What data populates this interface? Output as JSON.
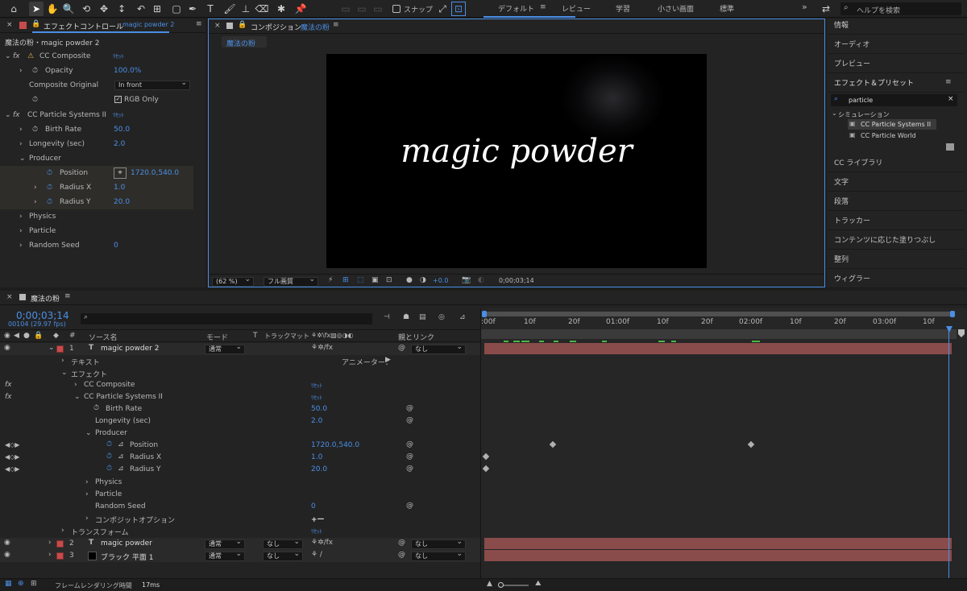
{
  "toolbar": {
    "snap_label": "スナップ",
    "search_placeholder": "ヘルプを検索",
    "workspaces": [
      "デフォルト",
      "レビュー",
      "学習",
      "小さい画面",
      "標準"
    ],
    "more": "»"
  },
  "effects_panel": {
    "tab_label": "エフェクトコントロール",
    "tab_layer": "magic powder 2",
    "breadcrumb": "魔法の粉・magic powder 2",
    "reset": "ﾘｾｯﾄ",
    "cc_composite": {
      "name": "CC Composite",
      "opacity_label": "Opacity",
      "opacity_value": "100.0%",
      "composite_original_label": "Composite Original",
      "composite_original_value": "In front",
      "rgb_only_label": "RGB Only"
    },
    "cc_particle": {
      "name": "CC Particle Systems II",
      "birth_rate_label": "Birth Rate",
      "birth_rate_value": "50.0",
      "longevity_label": "Longevity (sec)",
      "longevity_value": "2.0",
      "producer_label": "Producer",
      "position_label": "Position",
      "position_value": "1720.0,540.0",
      "radius_x_label": "Radius X",
      "radius_x_value": "1.0",
      "radius_y_label": "Radius Y",
      "radius_y_value": "20.0",
      "physics_label": "Physics",
      "particle_label": "Particle",
      "random_seed_label": "Random Seed",
      "random_seed_value": "0"
    }
  },
  "comp_panel": {
    "tab_prefix": "コンポジション",
    "tab_name": "魔法の粉",
    "subtab": "魔法の粉",
    "canvas_text": "magic powder",
    "zoom": "(62 %)",
    "quality": "フル画質",
    "exposure": "+0.0",
    "timecode": "0;00;03;14"
  },
  "right_panel": {
    "items_top": [
      "情報",
      "オーディオ",
      "プレビュー"
    ],
    "effects_presets_label": "エフェクト＆プリセット",
    "search_value": "particle",
    "category": "シミュレーション",
    "results": [
      "CC Particle Systems II",
      "CC Particle World"
    ],
    "items_bottom": [
      "CC ライブラリ",
      "文字",
      "段落",
      "トラッカー",
      "コンテンツに応じた塗りつぶし",
      "整列",
      "ウィグラー"
    ]
  },
  "timeline": {
    "tab_label": "魔法の粉",
    "timecode": "0;00;03;14",
    "frame_info": "00104 (29.97 fps)",
    "columns": {
      "source_name": "ソース名",
      "mode": "モード",
      "t": "T",
      "track_matte": "トラックマット",
      "parent": "親とリンク"
    },
    "layers": [
      {
        "num": "1",
        "name": "magic powder 2",
        "mode": "通常",
        "parent": "なし"
      },
      {
        "num": "2",
        "name": "magic powder",
        "mode": "通常",
        "matte": "なし",
        "parent": "なし"
      },
      {
        "num": "3",
        "name": "ブラック 平面 1",
        "mode": "通常",
        "matte": "なし",
        "parent": "なし"
      }
    ],
    "props": {
      "text": "テキスト",
      "animator": "アニメーター：",
      "effects": "エフェクト",
      "cc_composite": "CC Composite",
      "cc_particle": "CC Particle Systems II",
      "birth_rate": "Birth Rate",
      "birth_rate_value": "50.0",
      "longevity": "Longevity (sec)",
      "longevity_value": "2.0",
      "producer": "Producer",
      "position": "Position",
      "position_value": "1720.0,540.0",
      "radius_x": "Radius X",
      "radius_x_value": "1.0",
      "radius_y": "Radius Y",
      "radius_y_value": "20.0",
      "physics": "Physics",
      "particle": "Particle",
      "random_seed": "Random Seed",
      "random_seed_value": "0",
      "composite_options": "コンポジットオプション",
      "composite_options_value": "+ー",
      "transform": "トランスフォーム",
      "reset": "ﾘｾｯﾄ"
    },
    "ruler_labels": [
      ":00f",
      "10f",
      "20f",
      "01:00f",
      "10f",
      "20f",
      "02:00f",
      "10f",
      "20f",
      "03:00f",
      "10f"
    ],
    "status_label": "フレームレンダリング時間",
    "status_value": "17ms"
  }
}
